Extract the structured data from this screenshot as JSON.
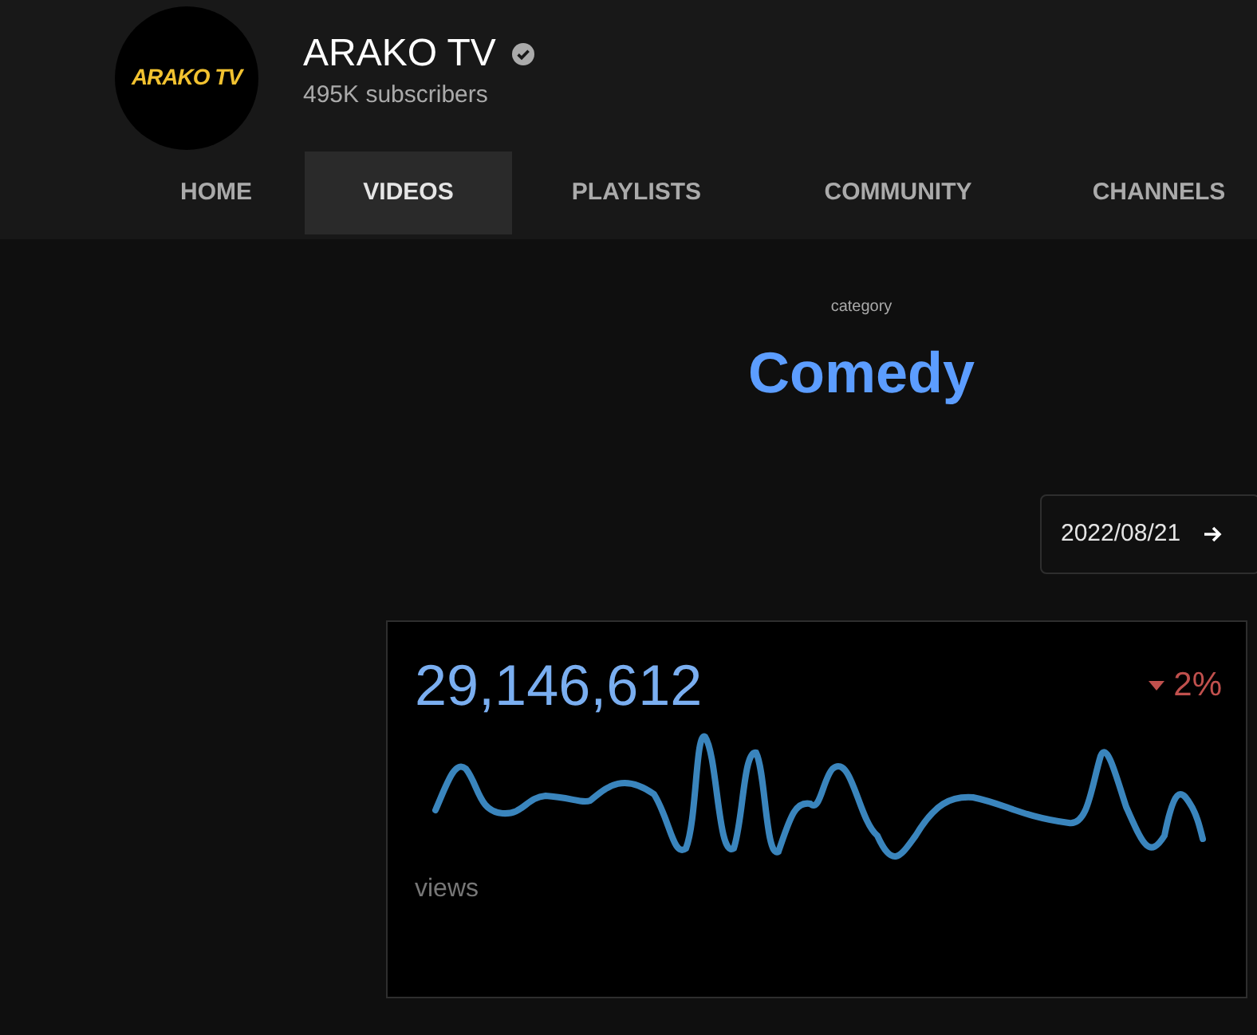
{
  "channel": {
    "logo_text": "ARAKO TV",
    "name": "ARAKO TV",
    "verified": true,
    "subscribers": "495K subscribers"
  },
  "tabs": [
    {
      "label": "HOME",
      "selected": false
    },
    {
      "label": "VIDEOS",
      "selected": true
    },
    {
      "label": "PLAYLISTS",
      "selected": false
    },
    {
      "label": "COMMUNITY",
      "selected": false
    },
    {
      "label": "CHANNELS",
      "selected": false
    }
  ],
  "category": {
    "label": "category",
    "value": "Comedy"
  },
  "date_button": {
    "label": "2022/08/21"
  },
  "stat_card": {
    "value": "29,146,612",
    "change": "2%",
    "down": true,
    "caption": "views"
  }
}
